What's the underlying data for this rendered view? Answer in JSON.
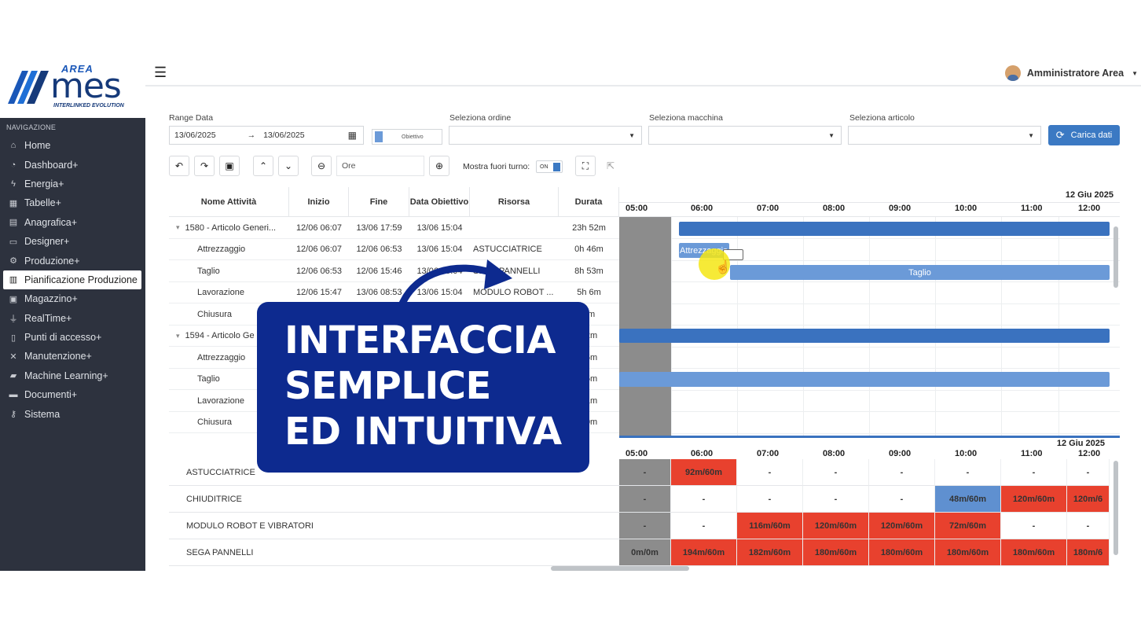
{
  "app": {
    "logo_area": "AREA",
    "logo_mes": "mes",
    "logo_tagline": "INTERLINKED EVOLUTION",
    "user_name": "Amministratore Area"
  },
  "sidebar": {
    "heading": "NAVIGAZIONE",
    "items": [
      {
        "label": "Home",
        "icon": "home-icon"
      },
      {
        "label": "Dashboard+",
        "icon": "dashboard-icon"
      },
      {
        "label": "Energia+",
        "icon": "bolt-icon"
      },
      {
        "label": "Tabelle+",
        "icon": "table-icon"
      },
      {
        "label": "Anagrafica+",
        "icon": "database-icon"
      },
      {
        "label": "Designer+",
        "icon": "monitor-icon"
      },
      {
        "label": "Produzione+",
        "icon": "cogs-icon"
      },
      {
        "label": "Pianificazione Produzione",
        "icon": "chart-icon",
        "active": true
      },
      {
        "label": "Magazzino+",
        "icon": "warehouse-icon"
      },
      {
        "label": "RealTime+",
        "icon": "plug-icon"
      },
      {
        "label": "Punti di accesso+",
        "icon": "id-card-icon"
      },
      {
        "label": "Manutenzione+",
        "icon": "wrench-icon"
      },
      {
        "label": "Machine Learning+",
        "icon": "car-icon"
      },
      {
        "label": "Documenti+",
        "icon": "folder-icon"
      },
      {
        "label": "Sistema",
        "icon": "key-icon"
      }
    ]
  },
  "filters": {
    "range_label": "Range Data",
    "date_from": "13/06/2025",
    "date_arrow": "→",
    "date_to": "13/06/2025",
    "objective_label": "Obiettivo",
    "order_label": "Seleziona ordine",
    "machine_label": "Seleziona macchina",
    "article_label": "Seleziona articolo",
    "load_button": "Carica dati"
  },
  "toolbar": {
    "zoom_unit": "Ore",
    "shift_label": "Mostra fuori turno:",
    "shift_toggle": "ON"
  },
  "table": {
    "columns": [
      "Nome Attività",
      "Inizio",
      "Fine",
      "Data Obiettivo",
      "Risorsa",
      "Durata"
    ],
    "rows": [
      {
        "name": "1580 - Articolo Generi...",
        "start": "12/06 06:07",
        "end": "13/06 17:59",
        "target": "13/06 15:04",
        "resource": "",
        "duration": "23h 52m",
        "group": true
      },
      {
        "name": "Attrezzaggio",
        "start": "12/06 06:07",
        "end": "12/06 06:53",
        "target": "13/06 15:04",
        "resource": "ASTUCCIATRICE",
        "duration": "0h 46m"
      },
      {
        "name": "Taglio",
        "start": "12/06 06:53",
        "end": "12/06 15:46",
        "target": "13/06 15:04",
        "resource": "SEGA PANNELLI",
        "duration": "8h 53m"
      },
      {
        "name": "Lavorazione",
        "start": "12/06 15:47",
        "end": "13/06 08:53",
        "target": "13/06 15:04",
        "resource": "MODULO ROBOT ...",
        "duration": "5h 6m"
      },
      {
        "name": "Chiusura",
        "start": "",
        "end": "",
        "target": "",
        "resource": "",
        "duration": "6m"
      },
      {
        "name": "1594 - Articolo Ge",
        "start": "",
        "end": "",
        "target": "",
        "resource": "",
        "duration": "32m",
        "group": true
      },
      {
        "name": "Attrezzaggio",
        "start": "",
        "end": "",
        "target": "",
        "resource": "",
        "duration": "15m"
      },
      {
        "name": "Taglio",
        "start": "",
        "end": "",
        "target": "",
        "resource": "",
        "duration": "35m"
      },
      {
        "name": "Lavorazione",
        "start": "",
        "end": "",
        "target": "",
        "resource": "",
        "duration": "51m"
      },
      {
        "name": "Chiusura",
        "start": "",
        "end": "",
        "target": "",
        "resource": "",
        "duration": "50m"
      }
    ]
  },
  "gantt": {
    "date_label": "12 Giu 2025",
    "hours": [
      "05:00",
      "06:00",
      "07:00",
      "08:00",
      "09:00",
      "10:00",
      "11:00",
      "12:00"
    ],
    "bar_setup_label": "Attrezzaggio",
    "bar_cut_label": "Taglio",
    "colors": {
      "group_bar": "#3a72bf",
      "task_bar": "#6b9ad8",
      "off_shift": "#8c8c8c",
      "overload": "#e8412e",
      "load_ok": "#5f90d0"
    }
  },
  "resources": {
    "date_label": "12 Giu 2025",
    "hours": [
      "05:00",
      "06:00",
      "07:00",
      "08:00",
      "09:00",
      "10:00",
      "11:00",
      "12:00"
    ],
    "rows": [
      {
        "name": "ASTUCCIATRICE",
        "cells": [
          "-",
          "92m/60m",
          "-",
          "-",
          "-",
          "-",
          "-",
          "-"
        ],
        "states": [
          "off",
          "over",
          "",
          "",
          "",
          "",
          "",
          ""
        ]
      },
      {
        "name": "CHIUDITRICE",
        "cells": [
          "-",
          "-",
          "-",
          "-",
          "-",
          "48m/60m",
          "120m/60m",
          "120m/6"
        ],
        "states": [
          "off",
          "",
          "",
          "",
          "",
          "ok",
          "over",
          "over"
        ]
      },
      {
        "name": "MODULO ROBOT E VIBRATORI",
        "cells": [
          "-",
          "-",
          "116m/60m",
          "120m/60m",
          "120m/60m",
          "72m/60m",
          "-",
          "-"
        ],
        "states": [
          "off",
          "",
          "over",
          "over",
          "over",
          "over",
          "",
          ""
        ]
      },
      {
        "name": "SEGA PANNELLI",
        "cells": [
          "0m/0m",
          "194m/60m",
          "182m/60m",
          "180m/60m",
          "180m/60m",
          "180m/60m",
          "180m/60m",
          "180m/6"
        ],
        "states": [
          "off",
          "over",
          "over",
          "over",
          "over",
          "over",
          "over",
          "over"
        ]
      }
    ]
  },
  "overlay": {
    "line1": "INTERFACCIA",
    "line2": "SEMPLICE",
    "line3": "ED INTUITIVA"
  }
}
